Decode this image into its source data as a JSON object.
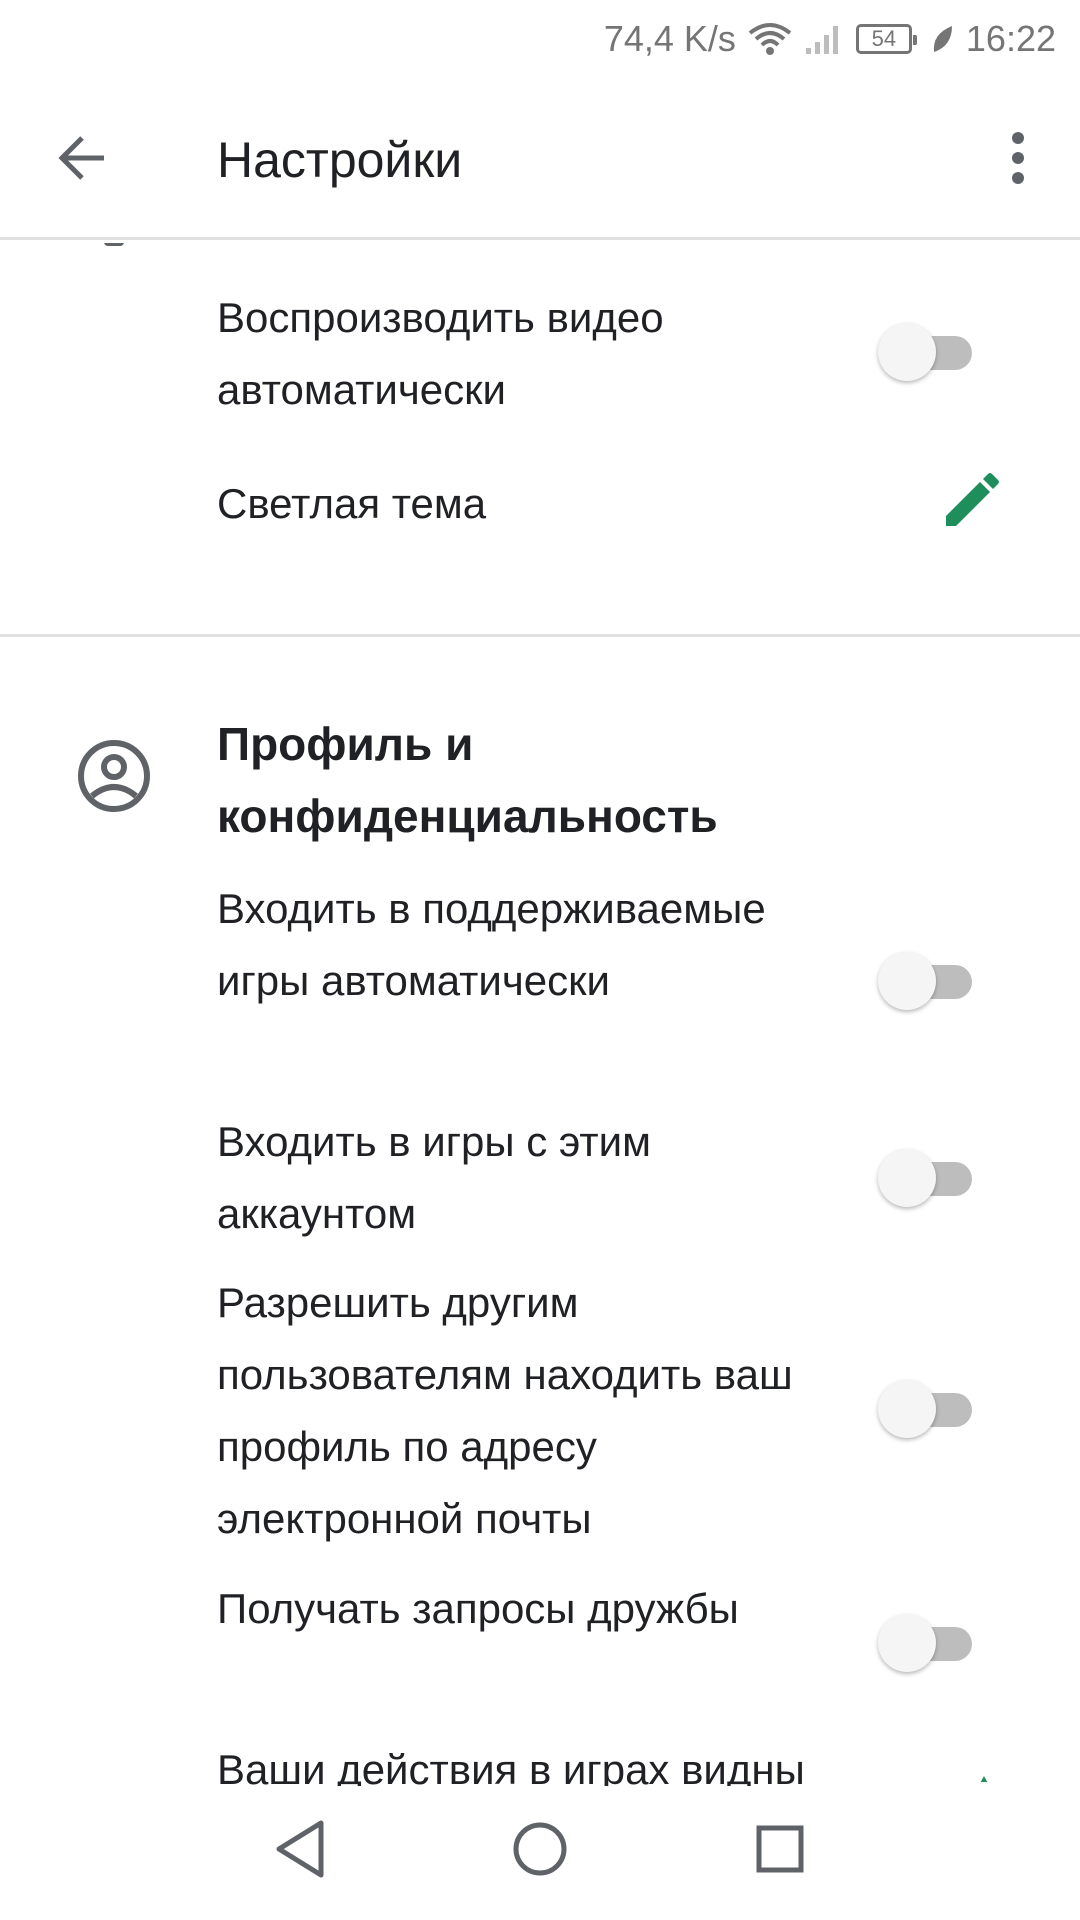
{
  "status_bar": {
    "speed": "74,4 K/s",
    "battery": "54",
    "time": "16:22",
    "icons": [
      "wifi-icon",
      "signal-icon",
      "battery-icon",
      "leaf-icon"
    ]
  },
  "app_bar": {
    "title": "Настройки",
    "back_icon": "arrow-left-icon",
    "more_icon": "more-vert-icon"
  },
  "general": {
    "autoplay_video": {
      "label": "Воспроизводить видео автоматически",
      "enabled": false
    },
    "light_theme": {
      "label": "Светлая тема",
      "icon": "pencil-icon",
      "color": "#1e8e5a"
    }
  },
  "profile_section": {
    "title": "Профиль и конфиденциальность",
    "icon": "account-circle-icon",
    "items": [
      {
        "label": "Входить в поддерживаемые игры автоматически",
        "enabled": false
      },
      {
        "label": "Входить в игры с этим аккаунтом",
        "enabled": false
      },
      {
        "label": "Разрешить другим пользователям находить ваш профиль по адресу электронной почты",
        "enabled": false
      },
      {
        "label": "Получать запросы дружбы",
        "enabled": false
      },
      {
        "label": "Ваши действия в играх видны"
      }
    ]
  },
  "nav_bar": {
    "icons": [
      "nav-back-icon",
      "nav-home-icon",
      "nav-recents-icon"
    ]
  },
  "colors": {
    "accent": "#1e8e5a",
    "divider": "#e0e0e0",
    "text": "#202124",
    "toggle_track": "#bdbdbd"
  }
}
